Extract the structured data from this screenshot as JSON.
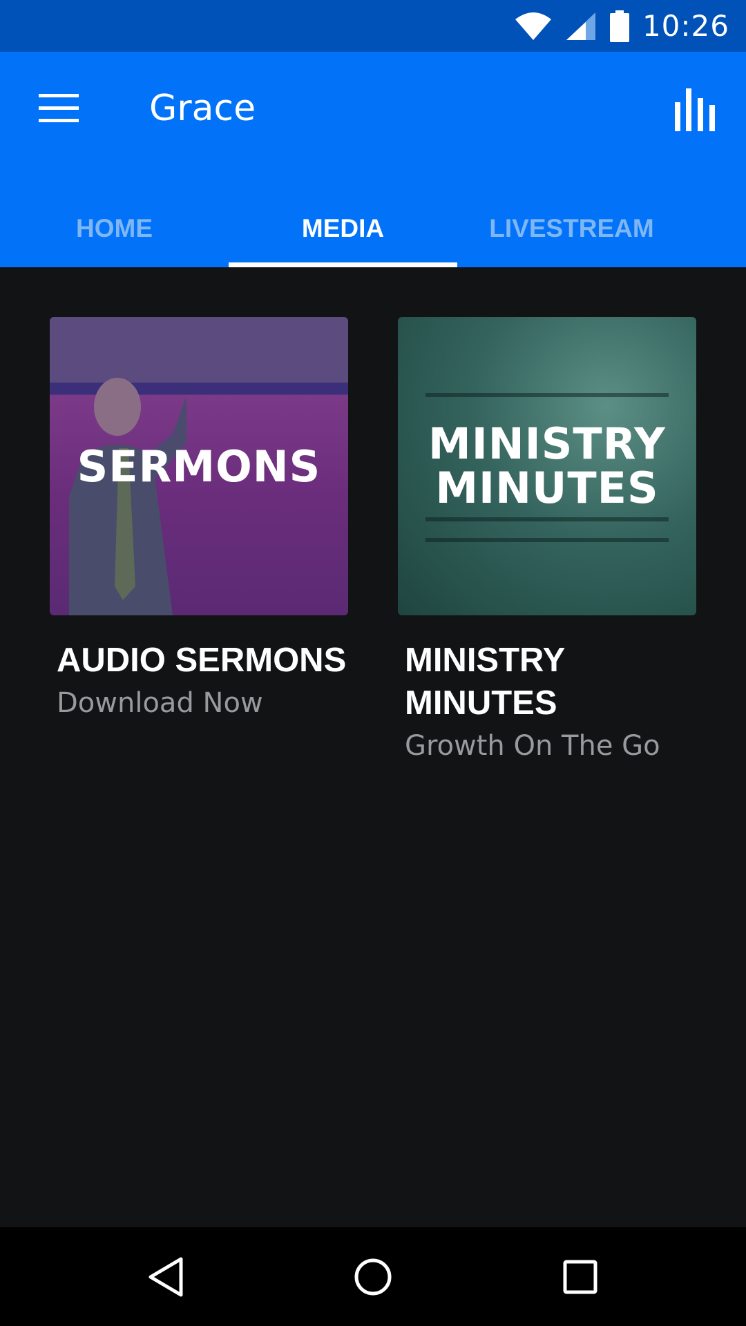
{
  "status_bar": {
    "time": "10:26",
    "icons": [
      "wifi-icon",
      "cell-signal-icon",
      "battery-icon"
    ]
  },
  "app_bar": {
    "title": "Grace",
    "menu_icon": "hamburger-menu-icon",
    "action_icon": "equalizer-icon",
    "background": "#0273f9"
  },
  "tabs": [
    {
      "label": "HOME",
      "active": false
    },
    {
      "label": "MEDIA",
      "active": true
    },
    {
      "label": "LIVESTREAM",
      "active": false
    }
  ],
  "cards": [
    {
      "thumbnail_text": "SERMONS",
      "title": "AUDIO SERMONS",
      "subtitle": "Download Now"
    },
    {
      "thumbnail_text_line1": "MINISTRY",
      "thumbnail_text_line2": "MINUTES",
      "title": "MINISTRY MINUTES",
      "subtitle": "Growth On The Go"
    }
  ],
  "nav_bar": {
    "icons": [
      "back-icon",
      "home-icon",
      "recents-icon"
    ]
  },
  "colors": {
    "status_bar": "#0052b8",
    "accent": "#0273f9",
    "background": "#121315",
    "tab_inactive": "#7fb6f4"
  }
}
